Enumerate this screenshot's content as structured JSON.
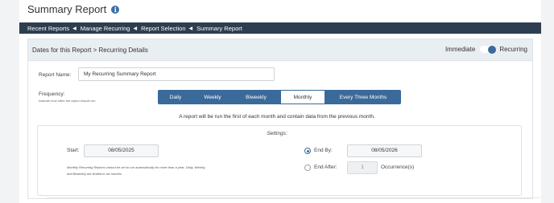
{
  "header": {
    "title": "Summary Report",
    "info_icon": "info-icon"
  },
  "breadcrumb": [
    "Recent Reports",
    "Manage Recurring",
    "Report Selection",
    "Summary Report"
  ],
  "panel": {
    "title": "Dates for this Report > Recurring Details",
    "toggle": {
      "left_label": "Immediate",
      "right_label": "Recurring",
      "state": "Recurring"
    }
  },
  "report_name": {
    "label": "Report Name:",
    "value": "My Recurring Summary Report"
  },
  "frequency": {
    "label": "Frequency:",
    "hint": "Indicate how often the report should run",
    "options": [
      "Daily",
      "Weekly",
      "Biweekly",
      "Monthly",
      "Every Three Months"
    ],
    "selected": "Monthly"
  },
  "summary": "A report will be run the first of each month and contain data from the previous month.",
  "settings": {
    "title": "Settings:",
    "start_label": "Start:",
    "start_value": "08/05/2025",
    "note_lines": [
      "Monthly Recurring Reports cannot be set to run automatically for more than a year. Daily, Weekly,",
      "and Biweekly are limited to six months."
    ],
    "end_by_label": "End By:",
    "end_by_value": "08/05/2026",
    "end_after_label": "End After:",
    "end_after_value": "1",
    "occurrences_label": "Occurrence(s)",
    "selected_end": "End By"
  },
  "colors": {
    "accent": "#3a6a9a",
    "breadcrumb_bg": "#2d3e50",
    "info": "#3d6fa5"
  }
}
